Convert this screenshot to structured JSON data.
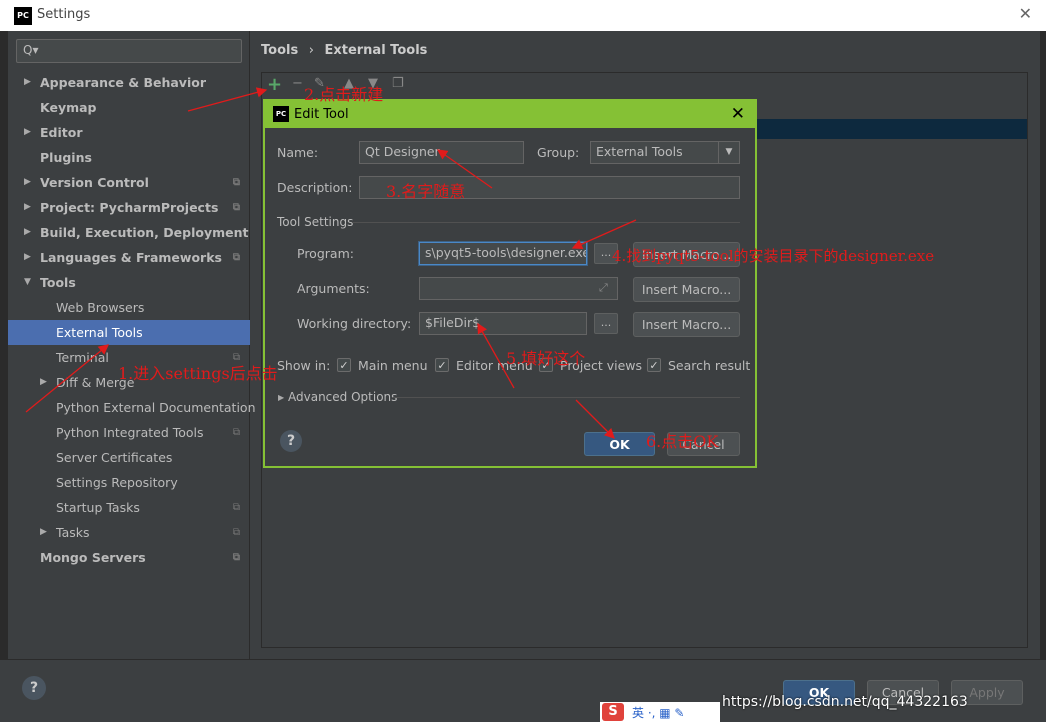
{
  "window": {
    "logo": "PC",
    "title": "Settings",
    "close_icon": "✕"
  },
  "search": {
    "icon": "search-icon",
    "glyph": "Q▾"
  },
  "sidebar": {
    "items": [
      {
        "label": "Appearance & Behavior",
        "bold": true,
        "arrow": true
      },
      {
        "label": "Keymap",
        "bold": true
      },
      {
        "label": "Editor",
        "bold": true,
        "arrow": true
      },
      {
        "label": "Plugins",
        "bold": true
      },
      {
        "label": "Version Control",
        "bold": true,
        "arrow": true,
        "copy": true
      },
      {
        "label": "Project: PycharmProjects",
        "bold": true,
        "arrow": true,
        "copy": true
      },
      {
        "label": "Build, Execution, Deployment",
        "bold": true,
        "arrow": true
      },
      {
        "label": "Languages & Frameworks",
        "bold": true,
        "arrow": true,
        "copy": true
      },
      {
        "label": "Tools",
        "bold": true,
        "arrow": true,
        "expanded": true
      },
      {
        "label": "Web Browsers"
      },
      {
        "label": "External Tools",
        "selected": true
      },
      {
        "label": "Terminal",
        "copy": true
      },
      {
        "label": "Diff & Merge",
        "arrow": true
      },
      {
        "label": "Python External Documentation"
      },
      {
        "label": "Python Integrated Tools",
        "copy": true
      },
      {
        "label": "Server Certificates"
      },
      {
        "label": "Settings Repository"
      },
      {
        "label": "Startup Tasks",
        "copy": true
      },
      {
        "label": "Tasks",
        "arrow": true,
        "copy": true
      },
      {
        "label": "Mongo Servers",
        "bold": true,
        "copy": true
      }
    ]
  },
  "breadcrumb": {
    "root": "Tools",
    "sep": "›",
    "leaf": "External Tools"
  },
  "dialog": {
    "logo": "PC",
    "title": "Edit Tool",
    "close": "✕",
    "name_label": "Name:",
    "name_value": "Qt Designer",
    "group_label": "Group:",
    "group_value": "External Tools",
    "description_label": "Description:",
    "description_value": "",
    "tool_settings_label": "Tool Settings",
    "program_label": "Program:",
    "program_value": "s\\pyqt5-tools\\designer.exe",
    "arguments_label": "Arguments:",
    "arguments_value": "",
    "workdir_label": "Working directory:",
    "workdir_value": "$FileDir$",
    "dots": "...",
    "insert_macro": "Insert Macro...",
    "show_in_label": "Show in:",
    "checkboxes": [
      {
        "label": "Main menu",
        "checked": true
      },
      {
        "label": "Editor menu",
        "checked": true
      },
      {
        "label": "Project views",
        "checked": true
      },
      {
        "label": "Search result",
        "checked": true
      }
    ],
    "advanced_label": "Advanced Options",
    "help": "?",
    "ok_label": "OK",
    "cancel_label": "Cancel"
  },
  "annotations": {
    "a1": "1.进入settings后点击",
    "a2": "2.点击新建",
    "a3": "3.名字随意",
    "a4": "4.找到pyqt5-tool的安装目录下的designer.exe",
    "a5": "5.填好这个",
    "a6": "6.点击OK"
  },
  "footer": {
    "help": "?",
    "ok_label": "OK",
    "cancel_label": "Cancel",
    "apply_label": "Apply",
    "watermark": "https://blog.csdn.net/qq_44322163",
    "ime_logo": "S",
    "ime_text": "英 ·, ▦ ✎"
  },
  "colors": {
    "accent": "#85c135",
    "selection": "#4b6eaf",
    "annotation": "#e01b1b",
    "primary_button": "#365880"
  }
}
